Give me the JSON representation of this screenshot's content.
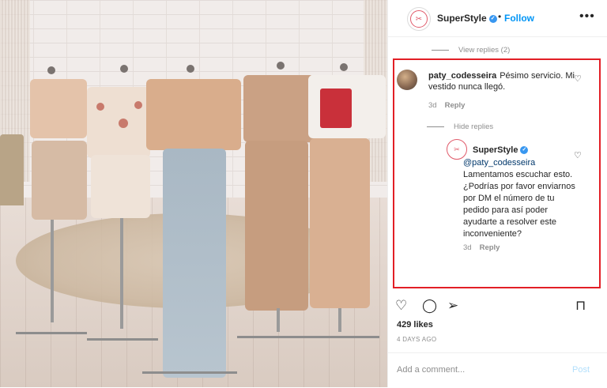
{
  "header": {
    "username": "SuperStyle",
    "separator": "•",
    "follow_label": "Follow",
    "more_icon": "ellipsis-icon"
  },
  "comments": {
    "view_replies": "View replies (2)",
    "first": {
      "username": "paty_codesseira",
      "text": "Pésimo servicio. Mi vestido nunca llegó.",
      "age": "3d",
      "reply_label": "Reply"
    },
    "hide_replies": "Hide replies",
    "reply": {
      "username": "SuperStyle",
      "mention": "@paty_codesseira",
      "text": "Lamentamos escuchar esto. ¿Podrías por favor enviarnos por DM el número de tu pedido para así poder ayudarte a resolver este inconveniente?",
      "age": "3d",
      "reply_label": "Reply"
    }
  },
  "post": {
    "likes": "429 likes",
    "age": "4 DAYS AGO",
    "add_comment_placeholder": "Add a comment...",
    "post_label": "Post"
  },
  "colors": {
    "highlight_border": "#e21f26",
    "follow_blue": "#0095f6",
    "verified_blue": "#3897f0"
  }
}
